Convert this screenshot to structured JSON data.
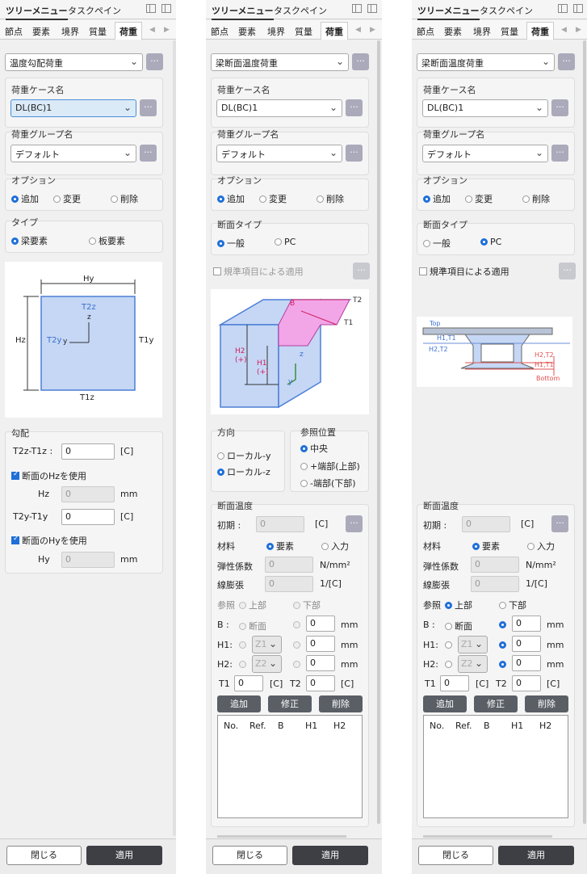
{
  "header": {
    "tree_menu": "ツリーメニュー",
    "task_pane": "タスクペイン"
  },
  "tabs": [
    "節点",
    "要素",
    "境界",
    "質量",
    "荷重"
  ],
  "panel1": {
    "load_type": "温度勾配荷重",
    "load_case_label": "荷重ケース名",
    "load_case": "DL(BC)1",
    "load_group_label": "荷重グループ名",
    "load_group": "デフォルト",
    "option_label": "オプション",
    "opt_add": "追加",
    "opt_change": "変更",
    "opt_delete": "削除",
    "type_label": "タイプ",
    "type_beam": "梁要素",
    "type_plate": "板要素",
    "fig": {
      "hy": "Hy",
      "hz": "Hz",
      "t2z": "T2z",
      "t2y": "T2y",
      "t1y": "T1y",
      "t1z": "T1z",
      "z": "z",
      "y": "y"
    },
    "gradient_label": "勾配",
    "t2z_t1z_label": "T2z-T1z :",
    "t2z_t1z": "0",
    "unit_c": "[C]",
    "use_hz": "断面のHzを使用",
    "hz_label": "Hz",
    "hz_value": "0",
    "mm": "mm",
    "t2y_t1y_label": "T2y-T1y",
    "t2y_t1y": "0",
    "use_hy": "断面のHyを使用",
    "hy_label": "Hy",
    "hy_value": "0"
  },
  "panel2": {
    "load_type": "梁断面温度荷重",
    "load_case_label": "荷重ケース名",
    "load_case": "DL(BC)1",
    "load_group_label": "荷重グループ名",
    "load_group": "デフォルト",
    "option_label": "オプション",
    "opt_add": "追加",
    "opt_change": "変更",
    "opt_delete": "削除",
    "section_type_label": "断面タイプ",
    "st_general": "一般",
    "st_pc": "PC",
    "by_standard": "規準項目による適用",
    "fig": {
      "b": "B",
      "t2": "T2",
      "t1": "T1",
      "h2": "H2",
      "h2s": "(+)",
      "h1": "H1",
      "h1s": "(+)",
      "z": "z",
      "y": "y"
    },
    "direction_label": "方向",
    "dir_local_y": "ローカル-y",
    "dir_local_z": "ローカル-z",
    "ref_label": "参照位置",
    "ref_center": "中央",
    "ref_plus": "+端部(上部)",
    "ref_minus": "-端部(下部)",
    "sec_temp_label": "断面温度",
    "initial_label": "初期 :",
    "initial": "0",
    "unit_c": "[C]",
    "material_label": "材料",
    "mat_elem": "要素",
    "mat_input": "入力",
    "elastic_label": "弾性係数",
    "elastic": "0",
    "elastic_unit": "N/mm²",
    "thermal_label": "線膨張",
    "thermal": "0",
    "thermal_unit": "1/[C]",
    "ref2_label": "参照",
    "ref2_top": "上部",
    "ref2_bottom": "下部",
    "b_label": "B :",
    "b_section": "断面",
    "b_value": "0",
    "mm": "mm",
    "h1_label": "H1:",
    "h1_sel": "Z1",
    "h1_value": "0",
    "h2_label": "H2:",
    "h2_sel": "Z2",
    "h2_value": "0",
    "t1_label": "T1",
    "t1_value": "0",
    "t2_label": "T2",
    "t2_value": "0",
    "btn_add": "追加",
    "btn_edit": "修正",
    "btn_delete": "削除",
    "cols": [
      "No.",
      "Ref.",
      "B",
      "H1",
      "H2"
    ]
  },
  "panel3": {
    "load_type": "梁断面温度荷重",
    "load_case_label": "荷重ケース名",
    "load_case": "DL(BC)1",
    "load_group_label": "荷重グループ名",
    "load_group": "デフォルト",
    "option_label": "オプション",
    "opt_add": "追加",
    "opt_change": "変更",
    "opt_delete": "削除",
    "section_type_label": "断面タイプ",
    "st_general": "一般",
    "st_pc": "PC",
    "by_standard": "規準項目による適用",
    "fig": {
      "top": "Top",
      "h1t1": "H1,T1",
      "h2t2": "H2,T2",
      "h2t2b": "H2,T2",
      "h1t1b": "H1,T1",
      "bottom": "Bottom"
    },
    "sec_temp_label": "断面温度",
    "initial_label": "初期 :",
    "initial": "0",
    "unit_c": "[C]",
    "material_label": "材料",
    "mat_elem": "要素",
    "mat_input": "入力",
    "elastic_label": "弾性係数",
    "elastic": "0",
    "elastic_unit": "N/mm²",
    "thermal_label": "線膨張",
    "thermal": "0",
    "thermal_unit": "1/[C]",
    "ref2_label": "参照",
    "ref2_top": "上部",
    "ref2_bottom": "下部",
    "b_label": "B :",
    "b_section": "断面",
    "b_value": "0",
    "mm": "mm",
    "h1_label": "H1:",
    "h1_sel": "Z1",
    "h1_value": "0",
    "h2_label": "H2:",
    "h2_sel": "Z2",
    "h2_value": "0",
    "t1_label": "T1",
    "t1_value": "0",
    "t2_label": "T2",
    "t2_value": "0",
    "btn_add": "追加",
    "btn_edit": "修正",
    "btn_delete": "削除",
    "cols": [
      "No.",
      "Ref.",
      "B",
      "H1",
      "H2"
    ]
  },
  "footer": {
    "close": "閉じる",
    "apply": "適用"
  },
  "colors": {
    "accent": "#1e6fd9",
    "fill_blue": "#c5d7f5",
    "fill_pink": "#f2a6e8"
  }
}
